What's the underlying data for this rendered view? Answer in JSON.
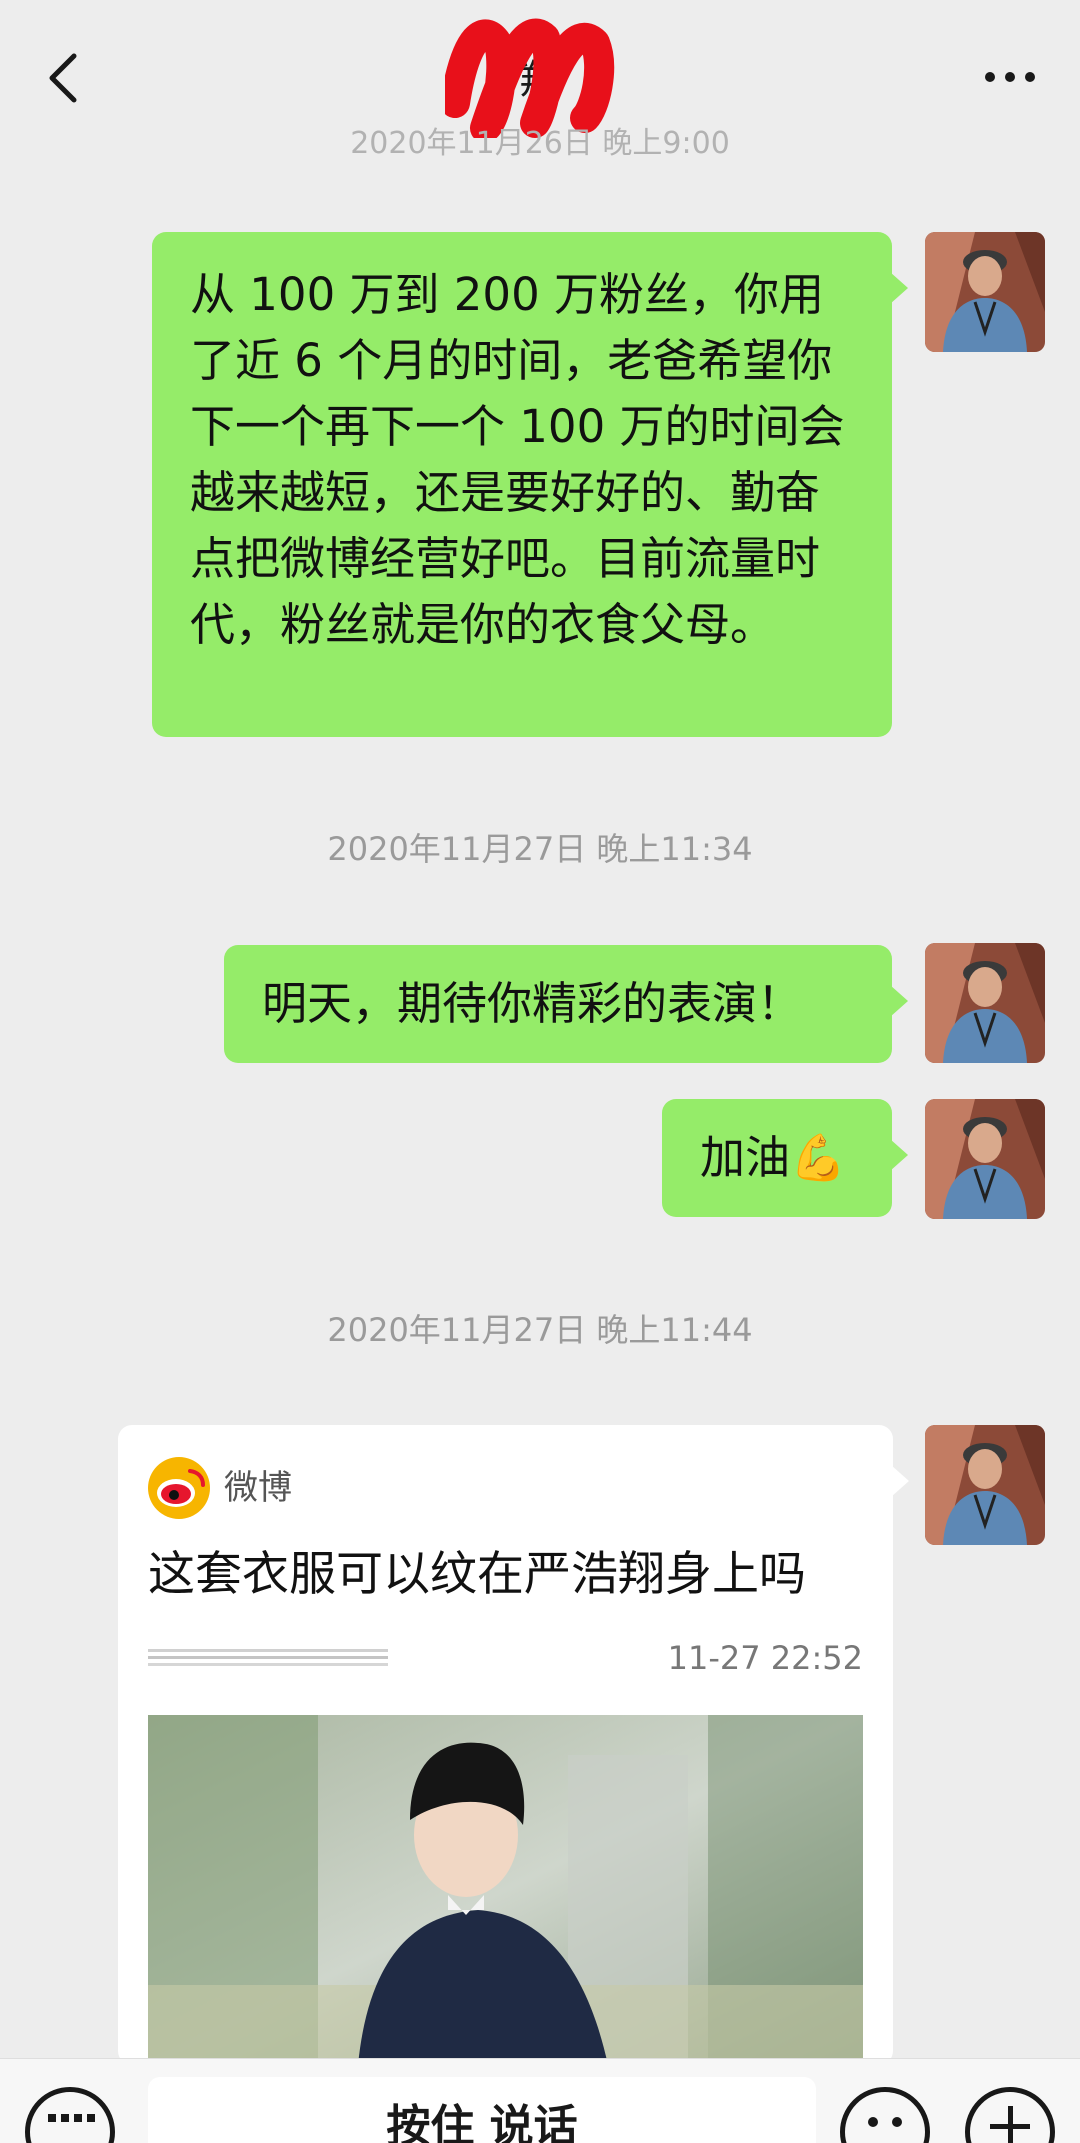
{
  "header": {
    "title": "翔",
    "timestamp_partial": "2020年11月26日 晚上9:00"
  },
  "messages": {
    "m1": "从 100 万到 200 万粉丝，你用了近 6 个月的时间，老爸希望你下一个再下一个 100 万的时间会越来越短，还是要好好的、勤奋点把微博经营好吧。目前流量时代，粉丝就是你的衣食父母。",
    "ts1": "2020年11月27日 晚上11:34",
    "m2": "明天，期待你精彩的表演！",
    "m3": "加油💪",
    "ts2": "2020年11月27日 晚上11:44"
  },
  "card": {
    "source": "微博",
    "title": "这套衣服可以纹在严浩翔身上吗",
    "time": "11-27 22:52"
  },
  "bottom_bar": {
    "hold_to_talk": "按住 说话"
  },
  "icons": {
    "back": "back-arrow-icon",
    "more": "more-dots-icon",
    "keyboard": "keyboard-icon",
    "emoji": "emoji-icon",
    "plus": "plus-icon",
    "weibo": "weibo-logo-icon"
  },
  "colors": {
    "bubble_green": "#95ec69",
    "background": "#ededed",
    "weibo_red": "#e6162d",
    "weibo_yellow": "#f7b500"
  }
}
